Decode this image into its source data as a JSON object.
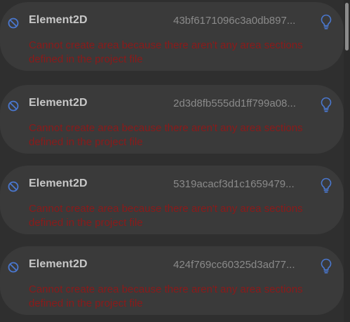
{
  "colors": {
    "background": "#2f2f2f",
    "card": "#3a3a3a",
    "title": "#c8c8c8",
    "id": "#8a8a8a",
    "error": "#8b1a1a",
    "icon_accent": "#4a78d0"
  },
  "icons": {
    "status": "prohibited-icon",
    "hint": "lightbulb-icon"
  },
  "issues": [
    {
      "title": "Element2D",
      "id": "43bf6171096c3a0db897...",
      "message": "Cannot create area because there aren't any area sections defined in the project file"
    },
    {
      "title": "Element2D",
      "id": "2d3d8fb555dd1ff799a08...",
      "message": "Cannot create area because there aren't any area sections defined in the project file"
    },
    {
      "title": "Element2D",
      "id": "5319acacf3d1c1659479...",
      "message": "Cannot create area because there aren't any area sections defined in the project file"
    },
    {
      "title": "Element2D",
      "id": "424f769cc60325d3ad77...",
      "message": "Cannot create area because there aren't any area sections defined in the project file"
    }
  ]
}
